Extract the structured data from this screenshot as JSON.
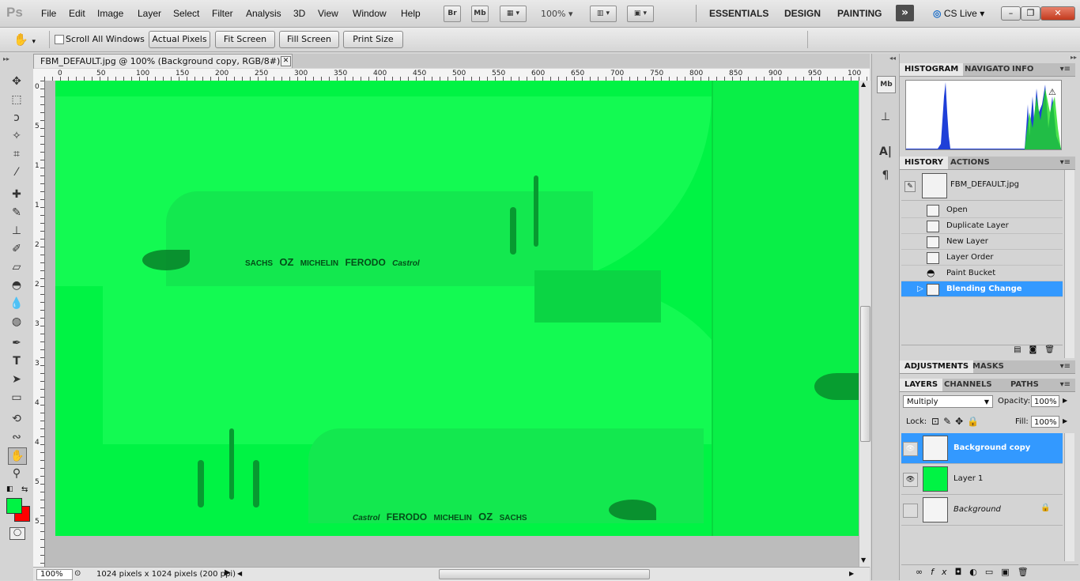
{
  "app": {
    "logo": "Ps"
  },
  "menu": [
    "File",
    "Edit",
    "Image",
    "Layer",
    "Select",
    "Filter",
    "Analysis",
    "3D",
    "View",
    "Window",
    "Help"
  ],
  "appbar": {
    "bridge": "Br",
    "minibridge": "Mb",
    "zoom": "100%"
  },
  "workspaces": [
    "ESSENTIALS",
    "DESIGN",
    "PAINTING"
  ],
  "cslive": "CS Live",
  "window_controls": {
    "minimize": "–",
    "restore": "❐",
    "close": "✕"
  },
  "options": {
    "scroll_all_windows": "Scroll All Windows",
    "actual_pixels": "Actual Pixels",
    "fit_screen": "Fit Screen",
    "fill_screen": "Fill Screen",
    "print_size": "Print Size"
  },
  "document": {
    "tab_title": "FBM_DEFAULT.jpg @ 100% (Background copy, RGB/8#) *",
    "close": "✕"
  },
  "ruler_h_labels": [
    "0",
    "50",
    "100",
    "150",
    "200",
    "250",
    "300",
    "350",
    "400",
    "450",
    "500",
    "550",
    "600",
    "650",
    "700",
    "750",
    "800",
    "850",
    "900",
    "950",
    "100"
  ],
  "ruler_v_labels": [
    "0",
    "5",
    "1",
    "1",
    "2",
    "2",
    "3",
    "3",
    "4",
    "4",
    "5",
    "5"
  ],
  "canvas_logos_top": [
    "SACHS",
    "OZ",
    "MICHELIN",
    "FERODO",
    "Castrol"
  ],
  "canvas_logos_bottom": [
    "Castrol",
    "FERODO",
    "MICHELIN",
    "OZ",
    "SACHS"
  ],
  "status": {
    "zoom": "100%",
    "info": "1024 pixels x 1024 pixels (200 ppi)"
  },
  "colors": {
    "foreground": "#00f344",
    "background": "#ff0000",
    "canvas": "#00f344",
    "selection": "#3399ff"
  },
  "panels": {
    "histogram_tabs": [
      "HISTOGRAM",
      "NAVIGATO",
      "INFO"
    ],
    "history_tabs": [
      "HISTORY",
      "ACTIONS"
    ],
    "history_snapshot": "FBM_DEFAULT.jpg",
    "history_items": [
      "Open",
      "Duplicate Layer",
      "New Layer",
      "Layer Order",
      "Paint Bucket",
      "Blending Change"
    ],
    "adjust_tabs": [
      "ADJUSTMENTS",
      "MASKS"
    ],
    "layers_tabs": [
      "LAYERS",
      "CHANNELS",
      "PATHS"
    ],
    "blend_mode": "Multiply",
    "opacity_label": "Opacity:",
    "opacity": "100%",
    "lock_label": "Lock:",
    "fill_label": "Fill:",
    "fill": "100%",
    "layers": [
      "Background copy",
      "Layer 1",
      "Background"
    ],
    "footer_icons": [
      "link-icon",
      "fx",
      "mask",
      "adjustment",
      "folder",
      "new",
      "trash"
    ]
  },
  "toolbox_icons": [
    "move-tool",
    "marquee-tool",
    "lasso-tool",
    "quick-select-tool",
    "crop-tool",
    "eyedropper-tool",
    "healing-tool",
    "brush-tool",
    "stamp-tool",
    "history-brush-tool",
    "eraser-tool",
    "paint-bucket-tool",
    "blur-tool",
    "dodge-tool",
    "pen-tool",
    "type-tool",
    "path-select-tool",
    "shape-tool",
    "3d-rotate-tool",
    "3d-orbit-tool",
    "hand-tool",
    "zoom-tool"
  ]
}
